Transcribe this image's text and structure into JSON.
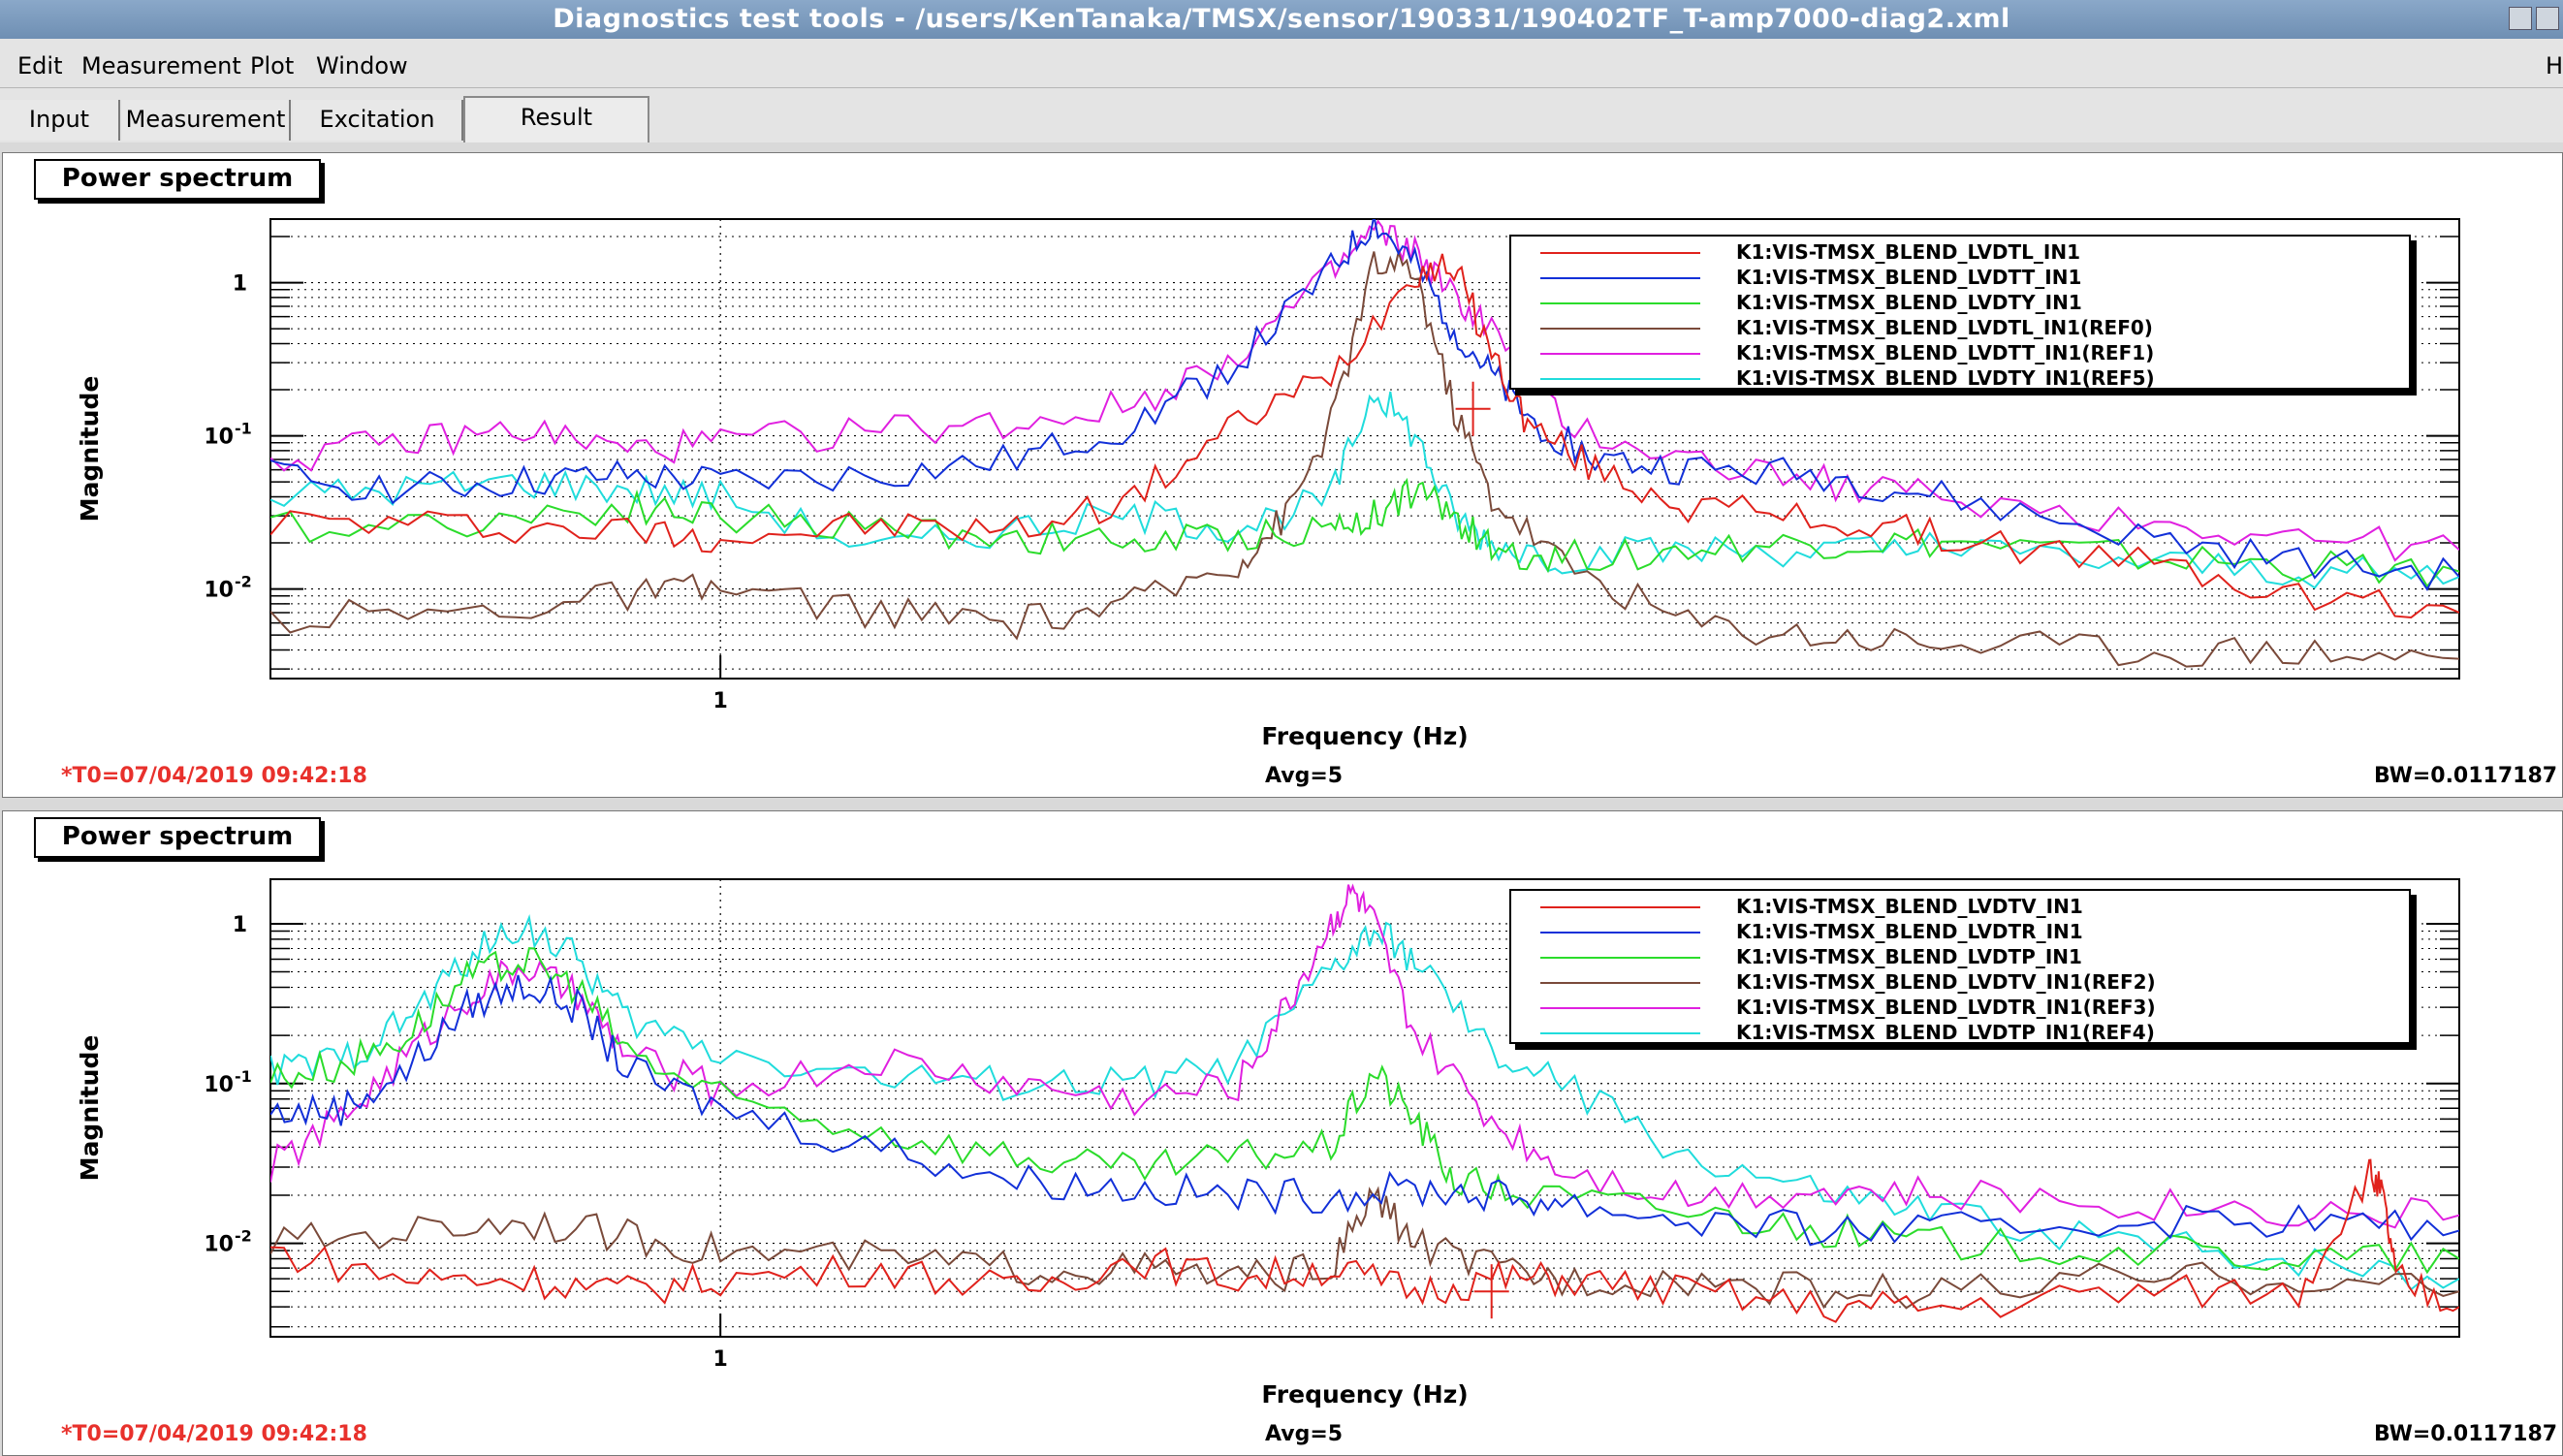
{
  "window": {
    "title": "Diagnostics test tools - /users/KenTanaka/TMSX/sensor/190331/190402TF_T-amp7000-diag2.xml"
  },
  "menubar": {
    "items": [
      {
        "label": "Edit"
      },
      {
        "label": "Measurement"
      },
      {
        "label": "Plot"
      },
      {
        "label": "Window"
      }
    ],
    "help_label": "H"
  },
  "tabs": [
    {
      "label": "Input"
    },
    {
      "label": "Measurement"
    },
    {
      "label": "Excitation"
    },
    {
      "label": "Result",
      "active": true
    }
  ],
  "panels": [
    {
      "label": "Power spectrum",
      "status": {
        "t0": "*T0=07/04/2019 09:42:18",
        "avg": "Avg=5",
        "bw": "BW=0.0117187"
      },
      "chart_data": {
        "type": "line",
        "title": "",
        "xlabel": "Frequency (Hz)",
        "ylabel": "Magnitude",
        "xscale": "log",
        "yscale": "log",
        "xlim": [
          0.6,
          7.2
        ],
        "ylim": [
          0.0026,
          2.6
        ],
        "x_ticks": [
          {
            "value": 1,
            "label": "1"
          }
        ],
        "y_ticks": [
          {
            "value": 1,
            "label": "1"
          },
          {
            "value": 0.1,
            "label": "10",
            "exp": "-1"
          },
          {
            "value": 0.01,
            "label": "10",
            "exp": "-2"
          }
        ],
        "grid": true,
        "legend_position": "top-right",
        "series": [
          {
            "name": "K1:VIS-TMSX_BLEND_LVDTL_IN1",
            "color": "#e0221c",
            "x": [
              0.6,
              0.75,
              0.9,
              1.0,
              1.2,
              1.4,
              1.6,
              1.8,
              2.0,
              2.2,
              2.3,
              2.4,
              2.5,
              2.7,
              3.0,
              3.5,
              4.0,
              5.0,
              6.0,
              7.2
            ],
            "y": [
              0.028,
              0.026,
              0.024,
              0.022,
              0.026,
              0.024,
              0.04,
              0.12,
              0.25,
              1.2,
              1.3,
              0.35,
              0.12,
              0.06,
              0.035,
              0.028,
              0.022,
              0.015,
              0.009,
              0.007
            ]
          },
          {
            "name": "K1:VIS-TMSX_BLEND_LVDTT_IN1",
            "color": "#1230d8",
            "x": [
              0.6,
              0.7,
              0.8,
              0.9,
              1.0,
              1.2,
              1.4,
              1.6,
              1.8,
              2.0,
              2.1,
              2.2,
              2.3,
              2.4,
              2.5,
              2.7,
              3.0,
              3.5,
              4.0,
              5.0,
              6.0,
              7.2
            ],
            "y": [
              0.055,
              0.045,
              0.05,
              0.055,
              0.05,
              0.055,
              0.07,
              0.12,
              0.3,
              1.2,
              2.5,
              1.3,
              0.5,
              0.25,
              0.13,
              0.07,
              0.06,
              0.055,
              0.04,
              0.022,
              0.015,
              0.012
            ]
          },
          {
            "name": "K1:VIS-TMSX_BLEND_LVDTY_IN1",
            "color": "#2bdc2b",
            "x": [
              0.6,
              0.75,
              0.9,
              1.0,
              1.2,
              1.4,
              1.6,
              1.8,
              2.0,
              2.1,
              2.2,
              2.3,
              2.4,
              2.6,
              3.0,
              3.5,
              4.0,
              5.0,
              6.0,
              7.2
            ],
            "y": [
              0.025,
              0.028,
              0.035,
              0.03,
              0.025,
              0.022,
              0.02,
              0.022,
              0.025,
              0.03,
              0.045,
              0.03,
              0.018,
              0.016,
              0.018,
              0.02,
              0.02,
              0.016,
              0.014,
              0.013
            ]
          },
          {
            "name": "K1:VIS-TMSX_BLEND_LVDTL_IN1(REF0)",
            "color": "#7a4a3a",
            "x": [
              0.6,
              0.75,
              0.9,
              1.0,
              1.2,
              1.4,
              1.6,
              1.8,
              1.9,
              2.0,
              2.1,
              2.2,
              2.3,
              2.4,
              2.6,
              3.0,
              3.5,
              4.0,
              5.0,
              6.0,
              7.2
            ],
            "y": [
              0.0065,
              0.007,
              0.009,
              0.01,
              0.007,
              0.006,
              0.008,
              0.015,
              0.03,
              0.12,
              1.3,
              1.2,
              0.15,
              0.04,
              0.015,
              0.006,
              0.005,
              0.0045,
              0.004,
              0.004,
              0.0035
            ]
          },
          {
            "name": "K1:VIS-TMSX_BLEND_LVDTT_IN1(REF1)",
            "color": "#e020e0",
            "x": [
              0.6,
              0.7,
              0.8,
              0.9,
              1.0,
              1.2,
              1.4,
              1.6,
              1.8,
              2.0,
              2.1,
              2.2,
              2.3,
              2.4,
              2.6,
              3.0,
              3.5,
              4.0,
              5.0,
              6.0,
              7.2
            ],
            "y": [
              0.07,
              0.09,
              0.11,
              0.08,
              0.09,
              0.11,
              0.12,
              0.16,
              0.35,
              1.1,
              2.2,
              1.6,
              0.8,
              0.5,
              0.12,
              0.07,
              0.05,
              0.04,
              0.028,
              0.022,
              0.018
            ]
          },
          {
            "name": "K1:VIS-TMSX_BLEND_LVDTY_IN1(REF5)",
            "color": "#20dcdc",
            "x": [
              0.6,
              0.7,
              0.8,
              0.9,
              1.0,
              1.2,
              1.4,
              1.6,
              1.8,
              2.0,
              2.1,
              2.2,
              2.3,
              2.4,
              2.6,
              3.0,
              3.5,
              4.0,
              5.0,
              6.0,
              7.2
            ],
            "y": [
              0.04,
              0.045,
              0.05,
              0.045,
              0.04,
              0.018,
              0.025,
              0.03,
              0.025,
              0.04,
              0.2,
              0.1,
              0.03,
              0.02,
              0.016,
              0.018,
              0.018,
              0.018,
              0.015,
              0.013,
              0.012
            ]
          }
        ]
      },
      "cursor": {
        "x": 2.35,
        "y": 0.15
      }
    },
    {
      "label": "Power spectrum",
      "status": {
        "t0": "*T0=07/04/2019 09:42:18",
        "avg": "Avg=5",
        "bw": "BW=0.0117187"
      },
      "chart_data": {
        "type": "line",
        "title": "",
        "xlabel": "Frequency (Hz)",
        "ylabel": "Magnitude",
        "xscale": "log",
        "yscale": "log",
        "xlim": [
          0.6,
          7.2
        ],
        "ylim": [
          0.0026,
          1.9
        ],
        "x_ticks": [
          {
            "value": 1,
            "label": "1"
          }
        ],
        "y_ticks": [
          {
            "value": 1,
            "label": "1"
          },
          {
            "value": 0.1,
            "label": "10",
            "exp": "-1"
          },
          {
            "value": 0.01,
            "label": "10",
            "exp": "-2"
          }
        ],
        "grid": true,
        "legend_position": "top-right",
        "series": [
          {
            "name": "K1:VIS-TMSX_BLEND_LVDTV_IN1",
            "color": "#e0221c",
            "x": [
              0.6,
              0.7,
              0.8,
              0.9,
              1.0,
              1.2,
              1.4,
              1.6,
              1.8,
              2.0,
              2.2,
              2.4,
              2.6,
              3.0,
              3.5,
              4.0,
              5.0,
              6.0,
              6.5,
              6.6,
              6.7,
              7.2
            ],
            "y": [
              0.009,
              0.006,
              0.006,
              0.005,
              0.006,
              0.007,
              0.005,
              0.008,
              0.006,
              0.007,
              0.005,
              0.006,
              0.006,
              0.005,
              0.004,
              0.004,
              0.005,
              0.005,
              0.028,
              0.02,
              0.006,
              0.004
            ]
          },
          {
            "name": "K1:VIS-TMSX_BLEND_LVDTR_IN1",
            "color": "#1230d8",
            "x": [
              0.6,
              0.65,
              0.7,
              0.75,
              0.8,
              0.85,
              0.9,
              1.0,
              1.2,
              1.4,
              1.6,
              1.8,
              2.0,
              2.2,
              2.4,
              2.6,
              3.0,
              3.5,
              4.0,
              5.0,
              6.0,
              7.2
            ],
            "y": [
              0.065,
              0.07,
              0.12,
              0.3,
              0.42,
              0.3,
              0.12,
              0.07,
              0.04,
              0.025,
              0.022,
              0.02,
              0.02,
              0.022,
              0.02,
              0.018,
              0.014,
              0.012,
              0.012,
              0.014,
              0.014,
              0.012
            ]
          },
          {
            "name": "K1:VIS-TMSX_BLEND_LVDTP_IN1",
            "color": "#2bdc2b",
            "x": [
              0.6,
              0.65,
              0.7,
              0.75,
              0.8,
              0.85,
              0.9,
              1.0,
              1.2,
              1.4,
              1.6,
              1.8,
              2.0,
              2.1,
              2.2,
              2.3,
              2.5,
              3.0,
              3.5,
              4.0,
              5.0,
              6.0,
              7.2
            ],
            "y": [
              0.11,
              0.13,
              0.2,
              0.45,
              0.6,
              0.4,
              0.16,
              0.08,
              0.05,
              0.035,
              0.028,
              0.035,
              0.04,
              0.12,
              0.06,
              0.025,
              0.02,
              0.016,
              0.012,
              0.01,
              0.009,
              0.008,
              0.008
            ]
          },
          {
            "name": "K1:VIS-TMSX_BLEND_LVDTV_IN1(REF2)",
            "color": "#7a4a3a",
            "x": [
              0.6,
              0.7,
              0.8,
              0.9,
              1.0,
              1.2,
              1.4,
              1.6,
              1.8,
              2.0,
              2.1,
              2.2,
              2.4,
              2.6,
              3.0,
              3.5,
              4.0,
              5.0,
              6.0,
              7.2
            ],
            "y": [
              0.01,
              0.012,
              0.014,
              0.011,
              0.009,
              0.008,
              0.007,
              0.007,
              0.006,
              0.007,
              0.02,
              0.01,
              0.007,
              0.006,
              0.006,
              0.005,
              0.005,
              0.006,
              0.006,
              0.005
            ]
          },
          {
            "name": "K1:VIS-TMSX_BLEND_LVDTR_IN1(REF3)",
            "color": "#e020e0",
            "x": [
              0.6,
              0.65,
              0.7,
              0.75,
              0.8,
              0.85,
              0.9,
              1.0,
              1.2,
              1.4,
              1.6,
              1.8,
              1.9,
              2.0,
              2.05,
              2.1,
              2.2,
              2.4,
              2.6,
              3.0,
              3.5,
              4.0,
              5.0,
              6.0,
              7.2
            ],
            "y": [
              0.03,
              0.06,
              0.15,
              0.35,
              0.55,
              0.35,
              0.15,
              0.09,
              0.14,
              0.1,
              0.08,
              0.1,
              0.3,
              1.0,
              1.6,
              1.0,
              0.2,
              0.06,
              0.03,
              0.02,
              0.022,
              0.02,
              0.018,
              0.016,
              0.015
            ]
          },
          {
            "name": "K1:VIS-TMSX_BLEND_LVDTP_IN1(REF4)",
            "color": "#20dcdc",
            "x": [
              0.6,
              0.65,
              0.7,
              0.75,
              0.8,
              0.85,
              0.9,
              1.0,
              1.2,
              1.4,
              1.6,
              1.8,
              2.0,
              2.1,
              2.2,
              2.4,
              2.6,
              3.0,
              3.5,
              4.0,
              5.0,
              6.0,
              7.2
            ],
            "y": [
              0.12,
              0.14,
              0.25,
              0.6,
              1.0,
              0.6,
              0.25,
              0.16,
              0.11,
              0.1,
              0.1,
              0.13,
              0.5,
              0.9,
              0.6,
              0.15,
              0.1,
              0.035,
              0.02,
              0.015,
              0.01,
              0.008,
              0.006
            ]
          }
        ]
      },
      "cursor": {
        "x": 2.4,
        "y": 0.005
      }
    }
  ]
}
